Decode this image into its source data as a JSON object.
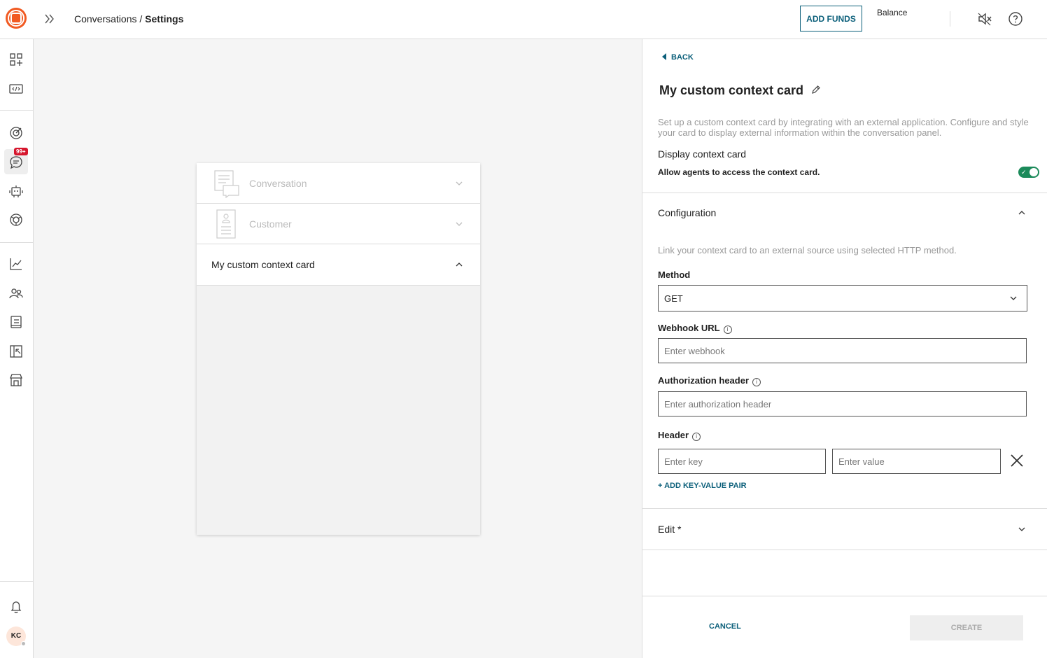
{
  "header": {
    "breadcrumb_parent": "Conversations",
    "breadcrumb_separator": " / ",
    "breadcrumb_current": "Settings",
    "add_funds_label": "ADD FUNDS",
    "balance_label": "Balance"
  },
  "sidebar": {
    "notification_badge": "99+",
    "avatar_initials": "KC",
    "icons": [
      "apps-icon",
      "code-icon",
      "target-icon",
      "chat-icon",
      "bot-icon",
      "network-icon",
      "analytics-icon",
      "people-icon",
      "book-icon",
      "export-icon",
      "store-icon",
      "bell-icon"
    ]
  },
  "preview": {
    "rows": [
      {
        "label": "Conversation",
        "expanded": false
      },
      {
        "label": "Customer",
        "expanded": false
      },
      {
        "label": "My custom context card",
        "expanded": true
      }
    ]
  },
  "panel": {
    "back_label": "BACK",
    "title": "My custom context card",
    "description": "Set up a custom context card by integrating with an external application. Configure and style your card to display external information within the conversation panel.",
    "display_label": "Display context card",
    "allow_label": "Allow agents to access the context card.",
    "toggle_on": true,
    "configuration": {
      "title": "Configuration",
      "description": "Link your context card to an external source using selected HTTP method.",
      "method_label": "Method",
      "method_value": "GET",
      "webhook_label": "Webhook URL",
      "webhook_placeholder": "Enter webhook",
      "auth_label": "Authorization header",
      "auth_placeholder": "Enter authorization header",
      "header_label": "Header",
      "key_placeholder": "Enter key",
      "value_placeholder": "Enter value",
      "add_pair_label": "+ ADD KEY-VALUE PAIR"
    },
    "edit_section_title": "Edit *",
    "cancel_label": "CANCEL",
    "create_label": "CREATE"
  },
  "colors": {
    "brand": "#f15a22",
    "accent": "#0b5f7a",
    "toggle_on": "#1b8a5a",
    "badge": "#d6162d"
  }
}
